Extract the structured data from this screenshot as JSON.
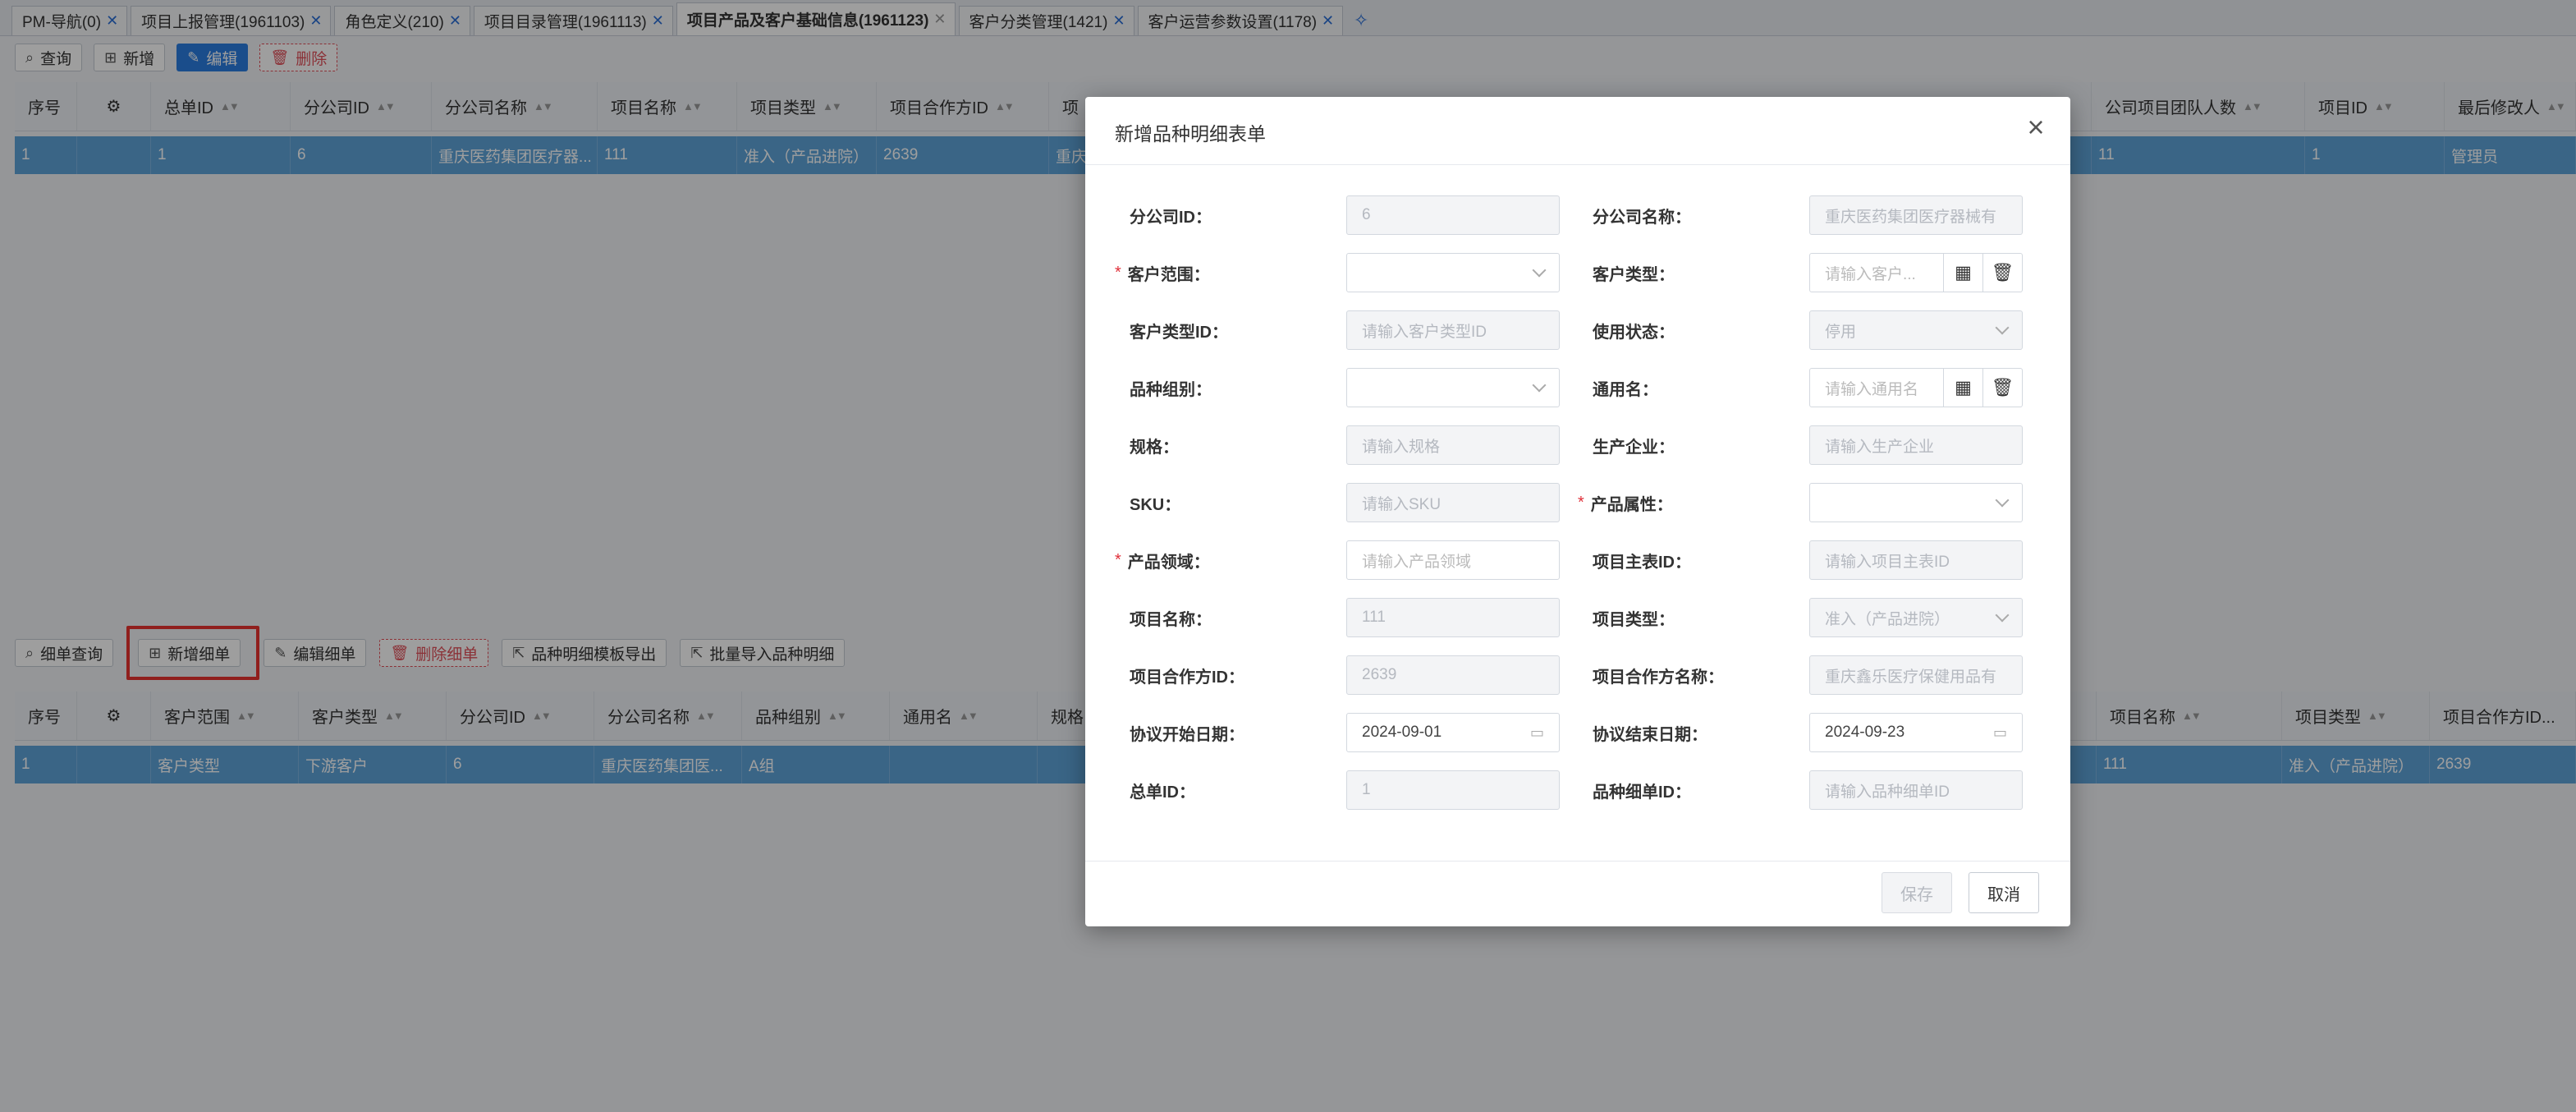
{
  "tabs": [
    {
      "label": "PM-导航(0)",
      "active": false
    },
    {
      "label": "项目上报管理(1961103)",
      "active": false
    },
    {
      "label": "角色定义(210)",
      "active": false
    },
    {
      "label": "项目目录管理(1961113)",
      "active": false
    },
    {
      "label": "项目产品及客户基础信息(1961123)",
      "active": true
    },
    {
      "label": "客户分类管理(1421)",
      "active": false
    },
    {
      "label": "客户运营参数设置(1178)",
      "active": false
    }
  ],
  "top_toolbar": {
    "query": "查询",
    "add": "新增",
    "edit": "编辑",
    "delete": "删除"
  },
  "top_table": {
    "columns": [
      "序号",
      "",
      "总单ID",
      "分公司ID",
      "分公司名称",
      "项目名称",
      "项目类型",
      "项目合作方ID",
      "项",
      "公司项目团队人数",
      "项目ID",
      "最后修改人"
    ],
    "row": [
      "1",
      "",
      "1",
      "6",
      "重庆医药集团医疗器...",
      "111",
      "准入（产品进院）",
      "2639",
      "重庆",
      "11",
      "1",
      "管理员"
    ]
  },
  "detail_toolbar": {
    "query": "细单查询",
    "add": "新增细单",
    "edit": "编辑细单",
    "delete": "删除细单",
    "export": "品种明细模板导出",
    "import": "批量导入品种明细"
  },
  "detail_table": {
    "columns": [
      "序号",
      "",
      "客户范围",
      "客户类型",
      "分公司ID",
      "分公司名称",
      "品种组别",
      "通用名",
      "规格",
      "项目名称",
      "项目类型",
      "项目合作方ID..."
    ],
    "row": [
      "1",
      "",
      "客户类型",
      "下游客户",
      "6",
      "重庆医药集团医...",
      "A组",
      "",
      "",
      "111",
      "准入（产品进院）",
      "2639"
    ]
  },
  "modal": {
    "title": "新增品种明细表单",
    "fields": {
      "branch_id": {
        "label": "分公司ID：",
        "value": "6"
      },
      "branch_name": {
        "label": "分公司名称：",
        "value": "重庆医药集团医疗器械有"
      },
      "customer_scope": {
        "label": "客户范围：",
        "value": ""
      },
      "customer_type": {
        "label": "客户类型：",
        "placeholder": "请输入客户..."
      },
      "customer_type_id": {
        "label": "客户类型ID：",
        "placeholder": "请输入客户类型ID"
      },
      "usage_status": {
        "label": "使用状态：",
        "value": "停用"
      },
      "variety_group": {
        "label": "品种组别：",
        "value": ""
      },
      "generic_name": {
        "label": "通用名：",
        "placeholder": "请输入通用名"
      },
      "spec": {
        "label": "规格：",
        "placeholder": "请输入规格"
      },
      "manufacturer": {
        "label": "生产企业：",
        "placeholder": "请输入生产企业"
      },
      "sku": {
        "label": "SKU：",
        "placeholder": "请输入SKU"
      },
      "product_attr": {
        "label": "产品属性：",
        "value": ""
      },
      "product_domain": {
        "label": "产品领域：",
        "placeholder": "请输入产品领域"
      },
      "project_master_id": {
        "label": "项目主表ID：",
        "placeholder": "请输入项目主表ID"
      },
      "project_name": {
        "label": "项目名称：",
        "value": "111"
      },
      "project_type": {
        "label": "项目类型：",
        "value": "准入（产品进院）"
      },
      "partner_id": {
        "label": "项目合作方ID：",
        "value": "2639"
      },
      "partner_name": {
        "label": "项目合作方名称：",
        "value": "重庆鑫乐医疗保健用品有"
      },
      "agreement_start": {
        "label": "协议开始日期：",
        "value": "2024-09-01"
      },
      "agreement_end": {
        "label": "协议结束日期：",
        "value": "2024-09-23"
      },
      "master_id": {
        "label": "总单ID：",
        "value": "1"
      },
      "detail_id": {
        "label": "品种细单ID：",
        "placeholder": "请输入品种细单ID"
      }
    },
    "save": "保存",
    "cancel": "取消"
  },
  "colors": {
    "primary": "#2b7de1",
    "selected_row": "#5ea3d9",
    "danger": "#e0505a",
    "highlight": "#e8322f",
    "required": "#e0303a"
  }
}
